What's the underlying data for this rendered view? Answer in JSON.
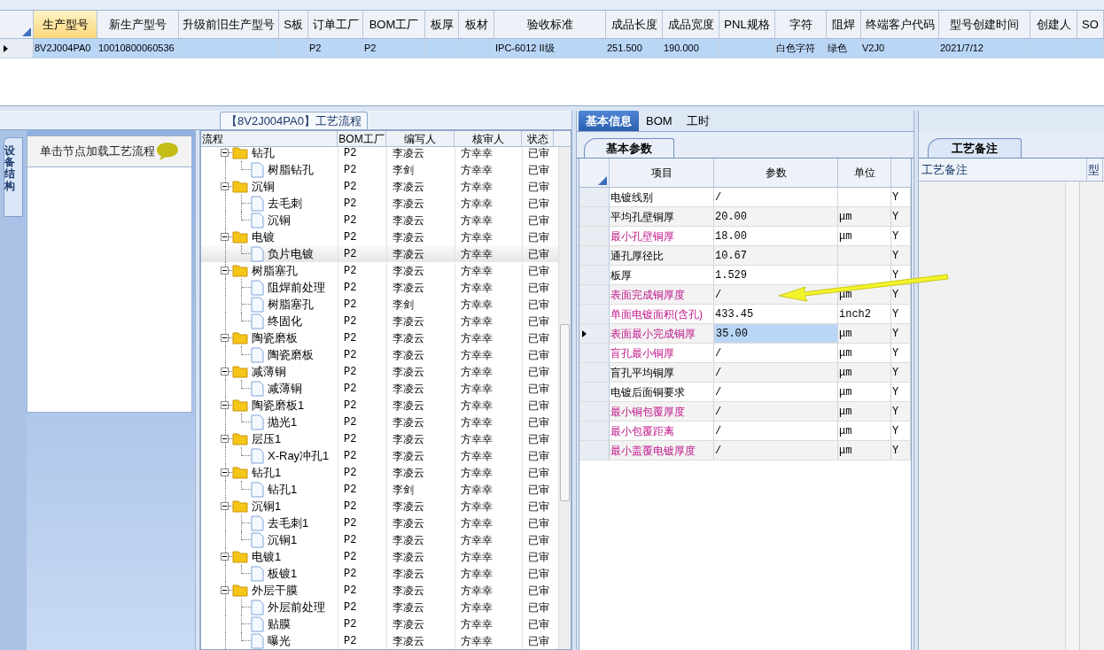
{
  "main_grid": {
    "columns": [
      {
        "label": "生产型号",
        "selected": true
      },
      {
        "label": "新生产型号",
        "selected": false
      },
      {
        "label": "升级前旧生产型号",
        "selected": false
      },
      {
        "label": "S板",
        "selected": false
      },
      {
        "label": "订单工厂",
        "selected": false
      },
      {
        "label": "BOM工厂",
        "selected": false
      },
      {
        "label": "板厚",
        "selected": false
      },
      {
        "label": "板材",
        "selected": false
      },
      {
        "label": "验收标准",
        "selected": false
      },
      {
        "label": "成品长度",
        "selected": false
      },
      {
        "label": "成品宽度",
        "selected": false
      },
      {
        "label": "PNL规格",
        "selected": false
      },
      {
        "label": "字符",
        "selected": false
      },
      {
        "label": "阻焊",
        "selected": false
      },
      {
        "label": "终端客户代码",
        "selected": false
      },
      {
        "label": "型号创建时间",
        "selected": false
      },
      {
        "label": "创建人",
        "selected": false
      },
      {
        "label": "SO",
        "selected": false
      }
    ],
    "rows": [
      {
        "selected": true,
        "cells": [
          "8V2J004PA0",
          "10010800060536",
          null,
          null,
          "P2",
          "P2",
          null,
          null,
          "IPC-6012 II级",
          "251.500",
          "190.000",
          null,
          "白色字符",
          "绿色",
          "V2J0",
          "2021/7/12",
          null,
          null
        ]
      }
    ]
  },
  "side_panel": {
    "vertical_tab": "设备结构",
    "header": "单击节点加载工艺流程"
  },
  "process_flow": {
    "title": "【8V2J004PA0】工艺流程",
    "columns": [
      "流程",
      "BOM工厂",
      "编写人",
      "核审人",
      "状态"
    ],
    "tree": [
      {
        "name": "钻孔",
        "kind": "folder",
        "expanded": true,
        "selected": false,
        "bom": "P2",
        "writer": "李凌云",
        "reviewer": "方幸幸",
        "status": "已审",
        "children": [
          {
            "name": "树脂钻孔",
            "kind": "file",
            "selected": false,
            "bom": "P2",
            "writer": "李剑",
            "reviewer": "方幸幸",
            "status": "已审"
          }
        ]
      },
      {
        "name": "沉铜",
        "kind": "folder",
        "expanded": true,
        "selected": false,
        "bom": "P2",
        "writer": "李凌云",
        "reviewer": "方幸幸",
        "status": "已审",
        "children": [
          {
            "name": "去毛刺",
            "kind": "file",
            "selected": false,
            "bom": "P2",
            "writer": "李凌云",
            "reviewer": "方幸幸",
            "status": "已审"
          },
          {
            "name": "沉铜",
            "kind": "file",
            "selected": false,
            "bom": "P2",
            "writer": "李凌云",
            "reviewer": "方幸幸",
            "status": "已审"
          }
        ]
      },
      {
        "name": "电镀",
        "kind": "folder",
        "expanded": true,
        "selected": false,
        "bom": "P2",
        "writer": "李凌云",
        "reviewer": "方幸幸",
        "status": "已审",
        "children": [
          {
            "name": "负片电镀",
            "kind": "file",
            "selected": true,
            "bom": "P2",
            "writer": "李凌云",
            "reviewer": "方幸幸",
            "status": "已审"
          }
        ]
      },
      {
        "name": "树脂塞孔",
        "kind": "folder",
        "expanded": true,
        "selected": false,
        "bom": "P2",
        "writer": "李凌云",
        "reviewer": "方幸幸",
        "status": "已审",
        "children": [
          {
            "name": "阻焊前处理",
            "kind": "file",
            "selected": false,
            "bom": "P2",
            "writer": "李凌云",
            "reviewer": "方幸幸",
            "status": "已审"
          },
          {
            "name": "树脂塞孔",
            "kind": "file",
            "selected": false,
            "bom": "P2",
            "writer": "李剑",
            "reviewer": "方幸幸",
            "status": "已审"
          },
          {
            "name": "终固化",
            "kind": "file",
            "selected": false,
            "bom": "P2",
            "writer": "李凌云",
            "reviewer": "方幸幸",
            "status": "已审"
          }
        ]
      },
      {
        "name": "陶瓷磨板",
        "kind": "folder",
        "expanded": true,
        "selected": false,
        "bom": "P2",
        "writer": "李凌云",
        "reviewer": "方幸幸",
        "status": "已审",
        "children": [
          {
            "name": "陶瓷磨板",
            "kind": "file",
            "selected": false,
            "bom": "P2",
            "writer": "李凌云",
            "reviewer": "方幸幸",
            "status": "已审"
          }
        ]
      },
      {
        "name": "减薄铜",
        "kind": "folder",
        "expanded": true,
        "selected": false,
        "bom": "P2",
        "writer": "李凌云",
        "reviewer": "方幸幸",
        "status": "已审",
        "children": [
          {
            "name": "减薄铜",
            "kind": "file",
            "selected": false,
            "bom": "P2",
            "writer": "李凌云",
            "reviewer": "方幸幸",
            "status": "已审"
          }
        ]
      },
      {
        "name": "陶瓷磨板1",
        "kind": "folder",
        "expanded": true,
        "selected": false,
        "bom": "P2",
        "writer": "李凌云",
        "reviewer": "方幸幸",
        "status": "已审",
        "children": [
          {
            "name": "抛光1",
            "kind": "file",
            "selected": false,
            "bom": "P2",
            "writer": "李凌云",
            "reviewer": "方幸幸",
            "status": "已审"
          }
        ]
      },
      {
        "name": "层压1",
        "kind": "folder",
        "expanded": true,
        "selected": false,
        "bom": "P2",
        "writer": "李凌云",
        "reviewer": "方幸幸",
        "status": "已审",
        "children": [
          {
            "name": "X-Ray冲孔1",
            "kind": "file",
            "selected": false,
            "bom": "P2",
            "writer": "李凌云",
            "reviewer": "方幸幸",
            "status": "已审"
          }
        ]
      },
      {
        "name": "钻孔1",
        "kind": "folder",
        "expanded": true,
        "selected": false,
        "bom": "P2",
        "writer": "李凌云",
        "reviewer": "方幸幸",
        "status": "已审",
        "children": [
          {
            "name": "钻孔1",
            "kind": "file",
            "selected": false,
            "bom": "P2",
            "writer": "李剑",
            "reviewer": "方幸幸",
            "status": "已审"
          }
        ]
      },
      {
        "name": "沉铜1",
        "kind": "folder",
        "expanded": true,
        "selected": false,
        "bom": "P2",
        "writer": "李凌云",
        "reviewer": "方幸幸",
        "status": "已审",
        "children": [
          {
            "name": "去毛刺1",
            "kind": "file",
            "selected": false,
            "bom": "P2",
            "writer": "李凌云",
            "reviewer": "方幸幸",
            "status": "已审"
          },
          {
            "name": "沉铜1",
            "kind": "file",
            "selected": false,
            "bom": "P2",
            "writer": "李凌云",
            "reviewer": "方幸幸",
            "status": "已审"
          }
        ]
      },
      {
        "name": "电镀1",
        "kind": "folder",
        "expanded": true,
        "selected": false,
        "bom": "P2",
        "writer": "李凌云",
        "reviewer": "方幸幸",
        "status": "已审",
        "children": [
          {
            "name": "板镀1",
            "kind": "file",
            "selected": false,
            "bom": "P2",
            "writer": "李凌云",
            "reviewer": "方幸幸",
            "status": "已审"
          }
        ]
      },
      {
        "name": "外层干膜",
        "kind": "folder",
        "expanded": true,
        "selected": false,
        "bom": "P2",
        "writer": "李凌云",
        "reviewer": "方幸幸",
        "status": "已审",
        "children": [
          {
            "name": "外层前处理",
            "kind": "file",
            "selected": false,
            "bom": "P2",
            "writer": "李凌云",
            "reviewer": "方幸幸",
            "status": "已审"
          },
          {
            "name": "贴膜",
            "kind": "file",
            "selected": false,
            "bom": "P2",
            "writer": "李凌云",
            "reviewer": "方幸幸",
            "status": "已审"
          },
          {
            "name": "曝光",
            "kind": "file",
            "selected": false,
            "bom": "P2",
            "writer": "李凌云",
            "reviewer": "方幸幸",
            "status": "已审"
          }
        ]
      }
    ]
  },
  "detail": {
    "tabs": [
      {
        "label": "基本信息",
        "selected": true
      },
      {
        "label": "BOM",
        "selected": false
      },
      {
        "label": "工时",
        "selected": false
      }
    ],
    "sub_tab": "基本参数",
    "columns": [
      "项目",
      "参数",
      "单位"
    ],
    "rows": [
      {
        "name": "电镀线别",
        "value": "/",
        "column_4": "Y",
        "emphasized": false,
        "selected": false
      },
      {
        "name": "平均孔壁铜厚",
        "value": "20.00",
        "unit": "μm",
        "column_4": "Y",
        "emphasized": false,
        "selected": false
      },
      {
        "name": "最小孔壁铜厚",
        "value": "18.00",
        "unit": "μm",
        "column_4": "Y",
        "emphasized": true,
        "selected": false
      },
      {
        "name": "通孔厚径比",
        "value": "10.67",
        "column_4": "Y",
        "emphasized": false,
        "selected": false
      },
      {
        "name": "板厚",
        "value": "1.529",
        "column_4": "Y",
        "emphasized": false,
        "selected": false
      },
      {
        "name": "表面完成铜厚度",
        "value": "/",
        "unit": "μm",
        "column_4": "Y",
        "emphasized": true,
        "selected": false
      },
      {
        "name": "单面电镀面积(含孔)",
        "value": "433.45",
        "unit": "inch2",
        "column_4": "Y",
        "emphasized": true,
        "selected": false
      },
      {
        "name": "表面最小完成铜厚",
        "value": "35.00",
        "unit": "μm",
        "column_4": "Y",
        "emphasized": true,
        "selected": true
      },
      {
        "name": "盲孔最小铜厚",
        "value": "/",
        "unit": "μm",
        "column_4": "Y",
        "emphasized": true,
        "selected": false
      },
      {
        "name": "盲孔平均铜厚",
        "value": "/",
        "unit": "μm",
        "column_4": "Y",
        "emphasized": false,
        "selected": false
      },
      {
        "name": "电镀后面铜要求",
        "value": "/",
        "unit": "μm",
        "column_4": "Y",
        "emphasized": false,
        "selected": false
      },
      {
        "name": "最小铜包覆厚度",
        "value": "/",
        "unit": "μm",
        "column_4": "Y",
        "emphasized": true,
        "selected": false
      },
      {
        "name": "最小包覆距离",
        "value": "/",
        "unit": "μm",
        "column_4": "Y",
        "emphasized": true,
        "selected": false
      },
      {
        "name": "最小盖覆电镀厚度",
        "value": "/",
        "unit": "μm",
        "column_4": "Y",
        "emphasized": true,
        "selected": false
      }
    ]
  },
  "notes": {
    "tab": "工艺备注",
    "columns": [
      "工艺备注",
      "型"
    ]
  }
}
